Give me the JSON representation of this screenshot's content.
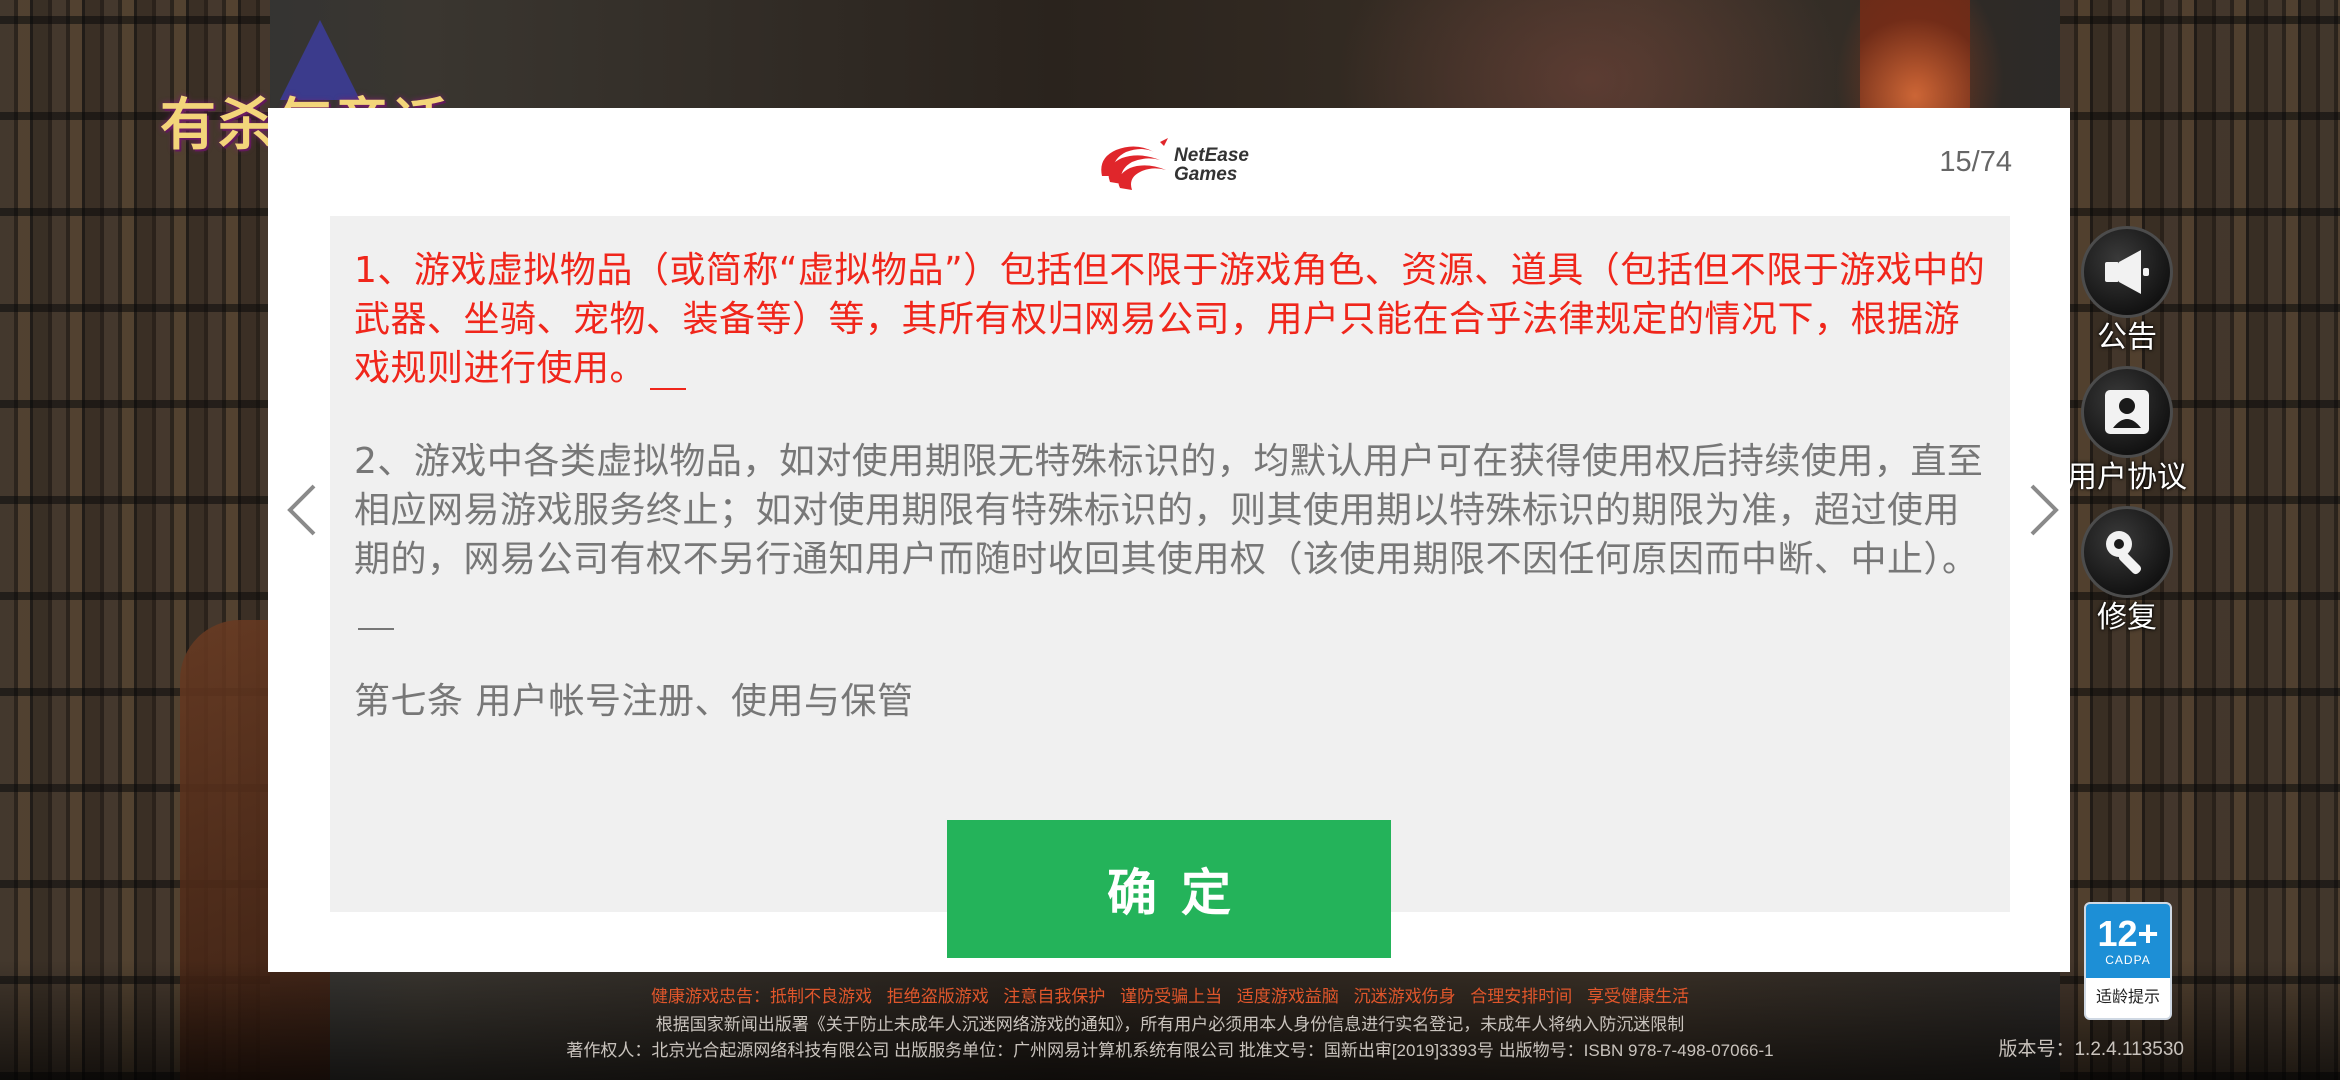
{
  "game": {
    "logo_text": "有杀气童话",
    "background_colors": {
      "accent_orange": "#e0562b",
      "shadow": "#1a1410"
    }
  },
  "dialog": {
    "brand_line1": "NetEase",
    "brand_line2": "Games",
    "brand_color": "#e0262b",
    "page_counter": "15/74",
    "paragraphs": [
      {
        "text": "1、游戏虚拟物品（或简称“虚拟物品”）包括但不限于游戏角色、资源、道具（包括但不限于游戏中的武器、坐骑、宠物、装备等）等，其所有权归网易公司，用户只能在合乎法律规定的情况下，根据游戏规则进行使用。",
        "color": "#f0261b"
      },
      {
        "text": "2、游戏中各类虚拟物品，如对使用期限无特殊标识的，均默认用户可在获得使用权后持续使用，直至相应网易游戏服务终止；如对使用期限有特殊标识的，则其使用期以特殊标识的期限为准，超过使用期的，网易公司有权不另行通知用户而随时收回其使用权（该使用期限不因任何原因而中断、中止）。",
        "color": "#777777"
      },
      {
        "text": "第七条 用户帐号注册、使用与保管",
        "color": "#777777"
      }
    ],
    "confirm_label": "确定",
    "confirm_color": "#24b35a",
    "nav_prev_icon": "chevron-left-icon",
    "nav_next_icon": "chevron-right-icon"
  },
  "side_buttons": [
    {
      "label": "公告",
      "icon": "megaphone-icon"
    },
    {
      "label": "用户协议",
      "icon": "user-card-icon"
    },
    {
      "label": "修复",
      "icon": "wrench-icon"
    }
  ],
  "age_rating": {
    "age": "12+",
    "org": "CADPA",
    "tip": "适龄提示",
    "color": "#1d8fd6"
  },
  "footer": {
    "health_notice": "健康游戏忠告：抵制不良游戏  拒绝盗版游戏  注意自我保护  谨防受骗上当  适度游戏益脑  沉迷游戏伤身  合理安排时间  享受健康生活",
    "law_notice": "根据国家新闻出版署《关于防止未成年人沉迷网络游戏的通知》，所有用户必须用本人身份信息进行实名登记，未成年人将纳入防沉迷限制",
    "copyright": "著作权人：北京光合起源网络科技有限公司  出版服务单位：广州网易计算机系统有限公司  批准文号：国新出审[2019]3393号  出版物号：ISBN  978-7-498-07066-1",
    "version": "版本号：1.2.4.113530"
  }
}
